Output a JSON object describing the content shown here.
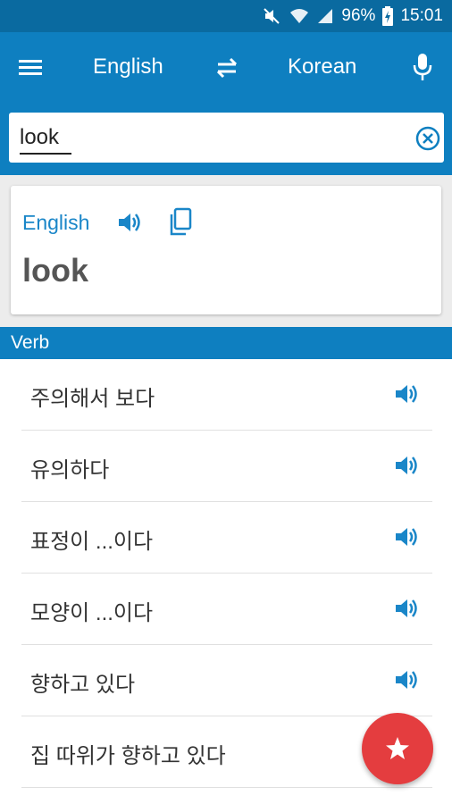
{
  "status_bar": {
    "battery_percent": "96%",
    "time": "15:01",
    "icons": [
      "mute-icon",
      "wifi-icon",
      "signal-icon",
      "battery-charging-icon"
    ]
  },
  "app_bar": {
    "source_language": "English",
    "target_language": "Korean",
    "icons": [
      "menu-icon",
      "swap-icon",
      "mic-icon"
    ]
  },
  "search": {
    "value": "look",
    "placeholder": ""
  },
  "result_card": {
    "language": "English",
    "word": "look",
    "icons": [
      "speaker-icon",
      "copy-icon"
    ]
  },
  "section": {
    "part_of_speech": "Verb"
  },
  "translations": [
    {
      "text": "주의해서 보다",
      "has_audio": true
    },
    {
      "text": "유의하다",
      "has_audio": true
    },
    {
      "text": "표정이 ...이다",
      "has_audio": true
    },
    {
      "text": "모양이 ...이다",
      "has_audio": true
    },
    {
      "text": "향하고 있다",
      "has_audio": true
    },
    {
      "text": "집 따위가 향하고 있다",
      "has_audio": false
    }
  ],
  "fab": {
    "icon": "star-icon"
  },
  "colors": {
    "status_bar": "#0a6aa0",
    "primary": "#0e7fc0",
    "accent_text": "#1a86c8",
    "fab": "#e43d3f"
  }
}
